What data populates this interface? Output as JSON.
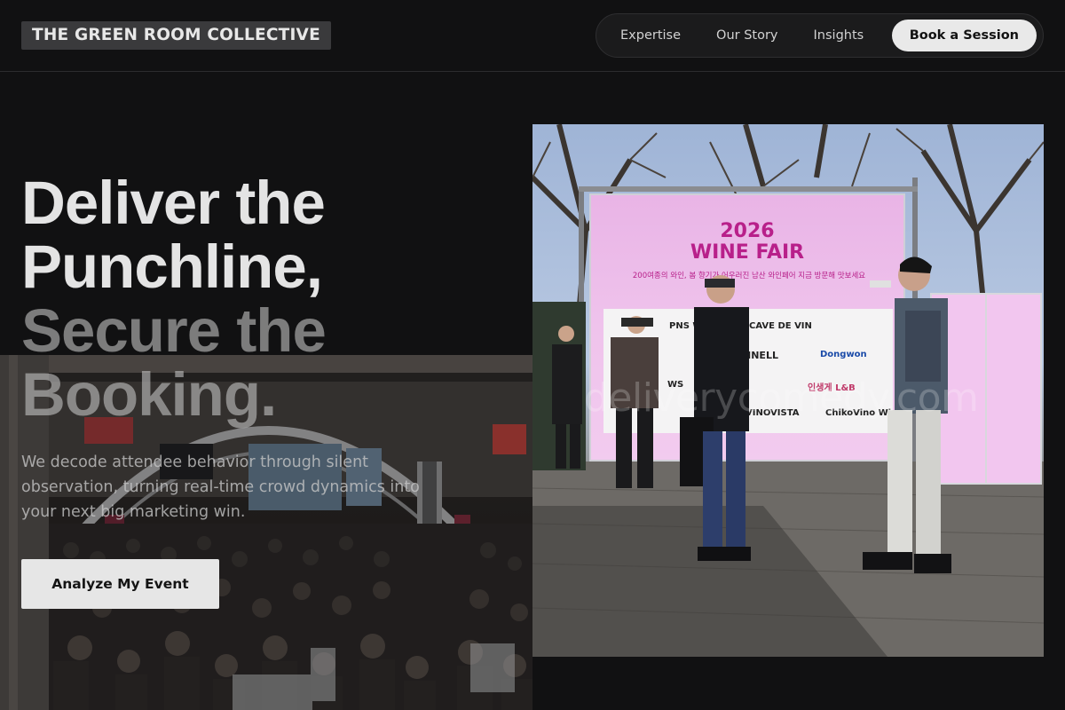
{
  "header": {
    "logo": "THE GREEN ROOM COLLECTIVE",
    "nav": [
      {
        "label": "Expertise"
      },
      {
        "label": "Our Story"
      },
      {
        "label": "Insights"
      }
    ],
    "cta_label": "Book a Session"
  },
  "hero": {
    "title_lines": [
      "Deliver the",
      "Punchline,",
      "Secure the",
      "Booking."
    ],
    "subtitle": "We decode attendee behavior through silent observation, turning real-time crowd dynamics into your next big marketing win.",
    "button_label": "Analyze My Event"
  },
  "fair_photo": {
    "banner_year": "2026",
    "banner_title": "WINE FAIR",
    "banner_korean": "200여종의 와인, 봄 향기가 어우러진 남산 와인페어 지금 방문해 맛보세요",
    "logos": [
      "PNS WINE",
      "CAVE DE VIN",
      "WINELL",
      "Dongwon",
      "WS",
      "인생게 L&B",
      "ChikoVino Wine",
      "VINOVISTA"
    ],
    "watermark": "deliverycomedy.com"
  },
  "colors": {
    "background": "#111112",
    "cta_bg": "#e9e9e9",
    "banner_pink": "#efc3ec",
    "banner_text": "#b8208a"
  }
}
